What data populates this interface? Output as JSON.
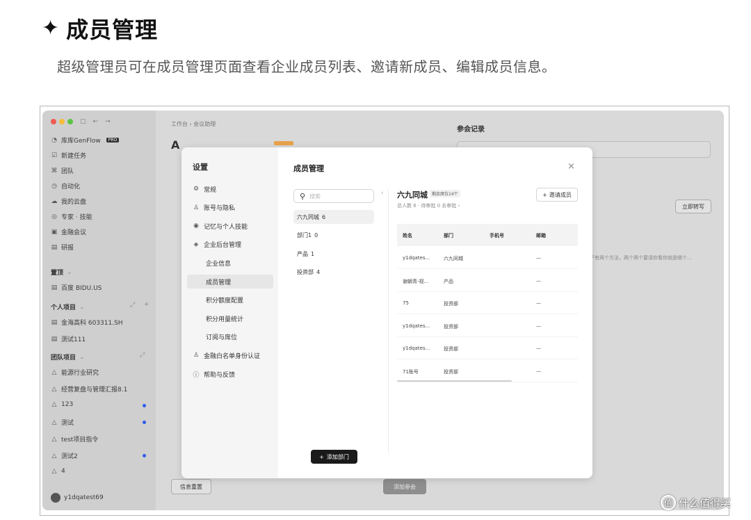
{
  "header": {
    "title": "成员管理",
    "subtitle": "超级管理员可在成员管理页面查看企业成员列表、邀请新成员、编辑成员信息。"
  },
  "sidebar": {
    "brand": "库库GenFlow",
    "pro": "PRO",
    "menu": [
      {
        "icon": "edit-icon",
        "label": "新建任务"
      },
      {
        "icon": "team-icon",
        "label": "团队"
      },
      {
        "icon": "automation-icon",
        "label": "自动化"
      },
      {
        "icon": "cloud-icon",
        "label": "我的云盘"
      },
      {
        "icon": "expert-icon",
        "label": "专家 · 技能"
      },
      {
        "icon": "meeting-icon",
        "label": "金融会议"
      },
      {
        "icon": "report-icon",
        "label": "研报"
      }
    ],
    "pinned_title": "置顶",
    "pinned": [
      {
        "label": "百度 BIDU.US"
      }
    ],
    "personal_title": "个人项目",
    "personal": [
      {
        "label": "金海高科 603311.SH"
      },
      {
        "label": "测试111"
      }
    ],
    "team_title": "团队项目",
    "team": [
      {
        "label": "能源行业研究",
        "dot": false
      },
      {
        "label": "经营复盘与管理汇报8.1",
        "dot": false
      },
      {
        "label": "123",
        "dot": true
      },
      {
        "label": "测试",
        "dot": true
      },
      {
        "label": "test项目指令",
        "dot": false
      },
      {
        "label": "测试2",
        "dot": true
      },
      {
        "label": "4",
        "dot": false
      }
    ],
    "user": "y1dqatest69"
  },
  "background": {
    "breadcrumb": "工作台 › 会议助理",
    "heading": "A",
    "right_panel_title": "参会记录",
    "right_button": "立即转写",
    "right_note": "好子有两个方法，两个两个要请你看你就是哪个...",
    "left_button": "信息重置",
    "center_button": "添加参会"
  },
  "settings": {
    "title": "设置",
    "items": [
      {
        "icon": "gear-icon",
        "label": "常规",
        "sub": false,
        "active": false
      },
      {
        "icon": "user-icon",
        "label": "账号与隐私",
        "sub": false,
        "active": false
      },
      {
        "icon": "memory-icon",
        "label": "记忆与个人技能",
        "sub": false,
        "active": false
      },
      {
        "icon": "admin-icon",
        "label": "企业后台管理",
        "sub": false,
        "active": false
      },
      {
        "icon": "",
        "label": "企业信息",
        "sub": true,
        "active": false
      },
      {
        "icon": "",
        "label": "成员管理",
        "sub": true,
        "active": true
      },
      {
        "icon": "",
        "label": "积分额度配置",
        "sub": true,
        "active": false
      },
      {
        "icon": "",
        "label": "积分用量统计",
        "sub": true,
        "active": false
      },
      {
        "icon": "",
        "label": "订阅与席位",
        "sub": true,
        "active": false
      },
      {
        "icon": "whitelist-icon",
        "label": "金融白名单身份认证",
        "sub": false,
        "active": false
      },
      {
        "icon": "help-icon",
        "label": "帮助与反馈",
        "sub": false,
        "active": false
      }
    ]
  },
  "members": {
    "title": "成员管理",
    "search_placeholder": "搜索",
    "departments": [
      {
        "name": "六九同城",
        "count": "6",
        "active": true
      },
      {
        "name": "部门1",
        "count": "0",
        "active": false
      },
      {
        "name": "产品",
        "count": "1",
        "active": false
      },
      {
        "name": "投资部",
        "count": "4",
        "active": false
      }
    ],
    "add_department": "添加部门",
    "org_name": "六九同城",
    "org_badge": "剩余席位14个",
    "org_summary": "总人数 6 · 待审批 0  去审批 ›",
    "invite": "邀请成员",
    "columns": [
      "姓名",
      "部门",
      "手机号",
      "邮箱"
    ],
    "rows": [
      [
        "y1dqates...",
        "六九同城",
        "",
        "—"
      ],
      [
        "谢朝青-视...",
        "产品",
        "",
        "—"
      ],
      [
        "75",
        "投资部",
        "",
        "—"
      ],
      [
        "y1dqates...",
        "投资部",
        "",
        "—"
      ],
      [
        "y1dqates...",
        "投资部",
        "",
        "—"
      ],
      [
        "71账号",
        "投资部",
        "",
        "—"
      ]
    ]
  },
  "watermark": "什么值得买"
}
